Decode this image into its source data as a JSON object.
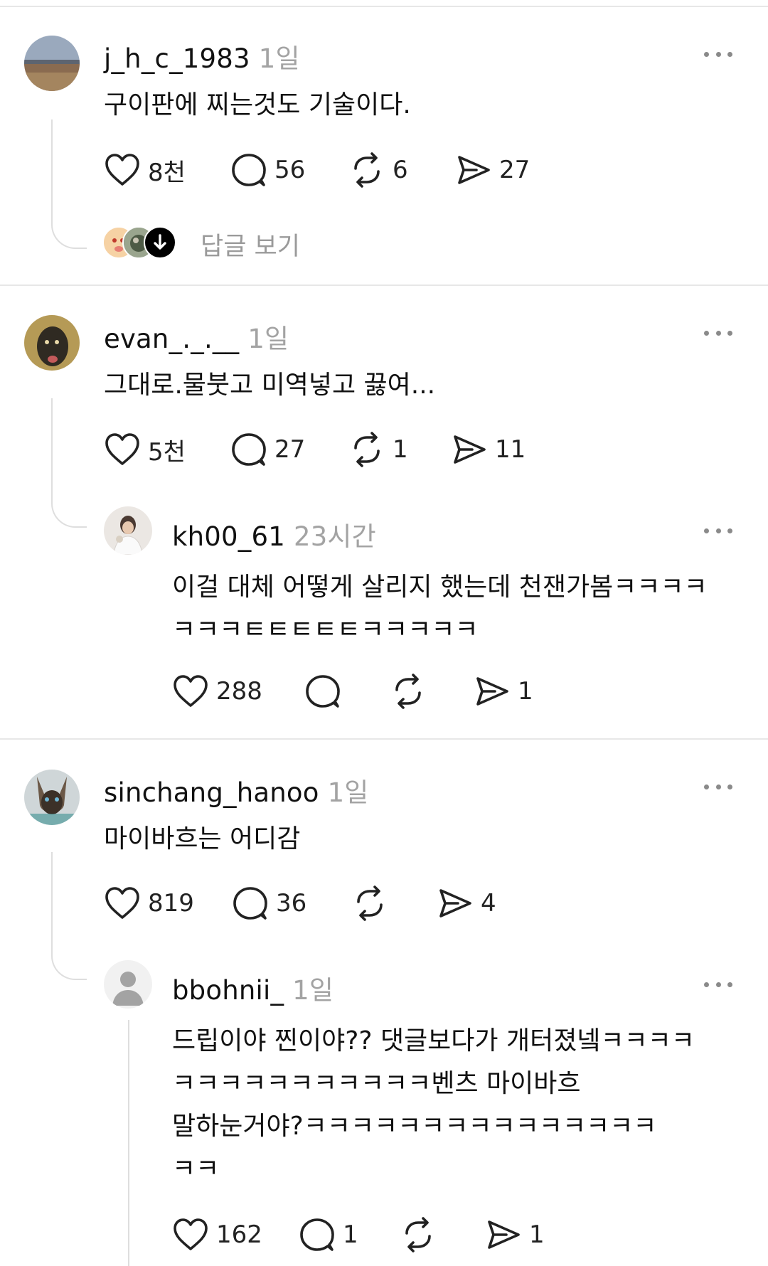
{
  "comments": [
    {
      "username": "j_h_c_1983",
      "time": "1일",
      "text": "구이판에 찌는것도 기술이다.",
      "likes": "8천",
      "replies": "56",
      "reposts": "6",
      "shares": "27",
      "view_replies_label": "답글 보기"
    },
    {
      "username": "evan_._.__",
      "time": "1일",
      "text": "그대로.물붓고 미역넣고 끓여...",
      "likes": "5천",
      "replies": "27",
      "reposts": "1",
      "shares": "11"
    },
    {
      "username": "kh00_61",
      "time": "23시간",
      "text_lines": [
        "이걸 대체 어떻게 살리지 했는데 천잰가봄ㅋㅋㅋㅋ",
        "ㅋㅋㅋㅌㅌㅌㅌㅌㅋㅋㅋㅋㅋ"
      ],
      "likes": "288",
      "replies": "",
      "reposts": "",
      "shares": "1"
    },
    {
      "username": "sinchang_hanoo",
      "time": "1일",
      "text": "마이바흐는 어디감",
      "likes": "819",
      "replies": "36",
      "reposts": "",
      "shares": "4"
    },
    {
      "username": "bbohnii_",
      "time": "1일",
      "text_lines": [
        "드립이야 찐이야?? 댓글보다가 개터졌넼ㅋㅋㅋㅋ",
        "ㅋㅋㅋㅋㅋㅋㅋㅋㅋㅋㅋ벤츠 마이바흐",
        "말하눈거야?ㅋㅋㅋㅋㅋㅋㅋㅋㅋㅋㅋㅋㅋㅋㅋ",
        "ㅋㅋ"
      ],
      "likes": "162",
      "replies": "1",
      "reposts": "",
      "shares": "1"
    }
  ],
  "colors": {
    "text": "#111111",
    "muted": "#a3a3a3",
    "divider": "#e7e7e7"
  },
  "icons": [
    "heart-icon",
    "comment-icon",
    "repost-icon",
    "share-icon",
    "more-icon",
    "arrow-down-icon"
  ]
}
